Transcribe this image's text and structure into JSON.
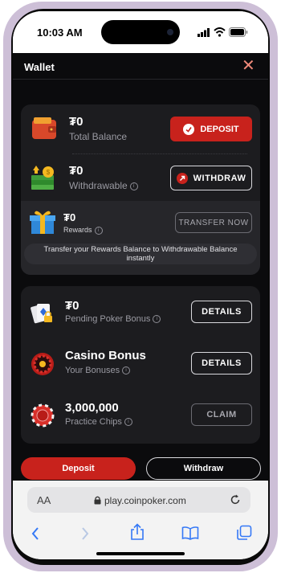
{
  "status_bar": {
    "time": "10:03 AM"
  },
  "header": {
    "title": "Wallet"
  },
  "balances": {
    "total": {
      "amount": "₮0",
      "label": "Total Balance",
      "button": "DEPOSIT"
    },
    "withdrawable": {
      "amount": "₮0",
      "label": "Withdrawable",
      "button": "WITHDRAW"
    },
    "rewards": {
      "amount": "₮0",
      "label": "Rewards",
      "button": "TRANSFER NOW",
      "note": "Transfer your Rewards Balance to Withdrawable Balance instantly"
    }
  },
  "bonuses": {
    "pending": {
      "amount": "₮0",
      "label": "Pending Poker Bonus",
      "button": "DETAILS"
    },
    "casino": {
      "title": "Casino Bonus",
      "label": "Your Bonuses",
      "button": "DETAILS"
    },
    "chips": {
      "amount": "3,000,000",
      "label": "Practice Chips",
      "button": "CLAIM"
    }
  },
  "footer_buttons": {
    "deposit": "Deposit",
    "withdraw": "Withdraw"
  },
  "safari": {
    "text_size": "AA",
    "url": "play.coinpoker.com"
  },
  "colors": {
    "accent_red": "#c8221c",
    "panel": "#1c1c1f",
    "background": "#0b0b0d"
  }
}
